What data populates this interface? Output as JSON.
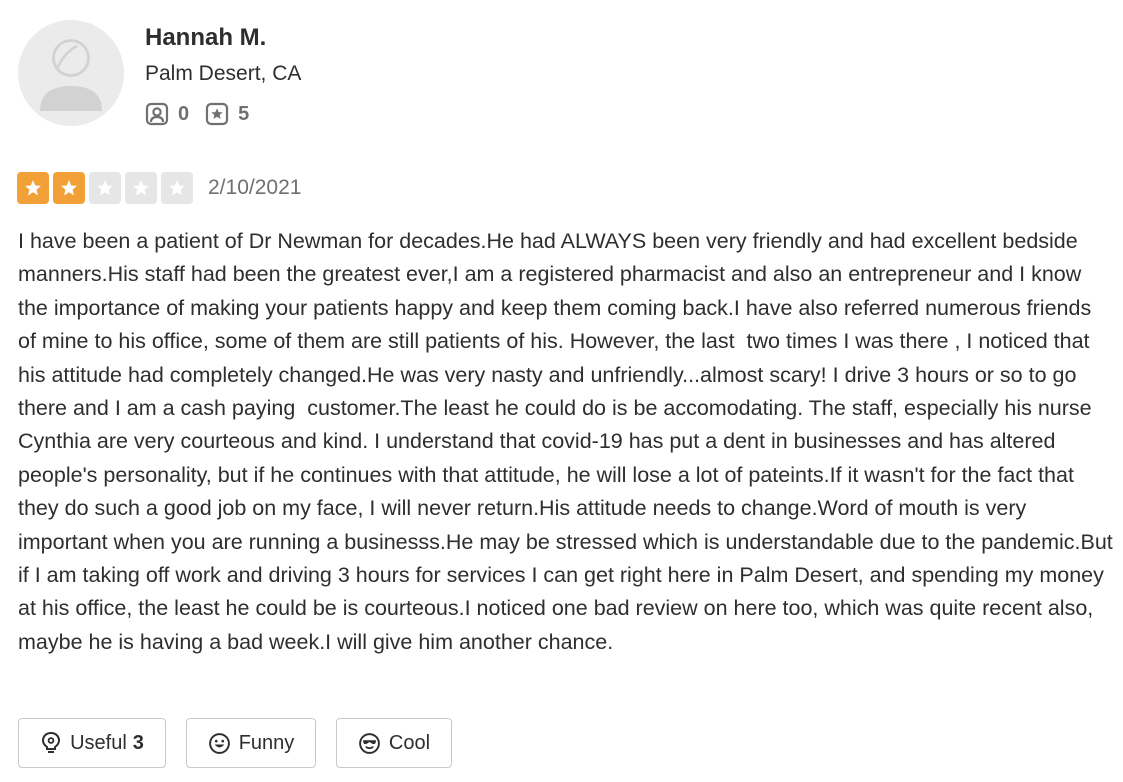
{
  "user": {
    "name": "Hannah M.",
    "location": "Palm Desert, CA",
    "friends_count": "0",
    "reviews_count": "5"
  },
  "review": {
    "rating": 2,
    "max_rating": 5,
    "date": "2/10/2021",
    "text": "I have been a patient of Dr Newman for decades.He had ALWAYS been very friendly and had excellent bedside manners.His staff had been the greatest ever,I am a registered pharmacist and also an entrepreneur and I know the importance of making your patients happy and keep them coming back.I have also referred numerous friends of mine to his office, some of them are still patients of his. However, the last  two times I was there , I noticed that his attitude had completely changed.He was very nasty and unfriendly...almost scary! I drive 3 hours or so to go there and I am a cash paying  customer.The least he could do is be accomodating. The staff, especially his nurse Cynthia are very courteous and kind. I understand that covid-19 has put a dent in businesses and has altered people's personality, but if he continues with that attitude, he will lose a lot of pateints.If it wasn't for the fact that they do such a good job on my face, I will never return.His attitude needs to change.Word of mouth is very important when you are running a businesss.He may be stressed which is understandable due to the pandemic.But if I am taking off work and driving 3 hours for services I can get right here in Palm Desert, and spending my money at his office, the least he could be is courteous.I noticed one bad review on here too, which was quite recent also, maybe he is having a bad week.I will give him another chance."
  },
  "reactions": {
    "useful_label": "Useful",
    "useful_count": "3",
    "funny_label": "Funny",
    "cool_label": "Cool"
  },
  "icons": {
    "avatar": "default-user-avatar-icon",
    "friends": "friends-icon",
    "reviews": "review-star-icon",
    "star": "star-icon",
    "useful": "lightbulb-icon",
    "funny": "smiley-face-icon",
    "cool": "sunglasses-face-icon"
  },
  "colors": {
    "star_filled": "#f1a138",
    "star_empty": "#e6e6e6",
    "text": "#2d2e2f",
    "muted": "#6e7072",
    "button_border": "#c8c9ca"
  }
}
